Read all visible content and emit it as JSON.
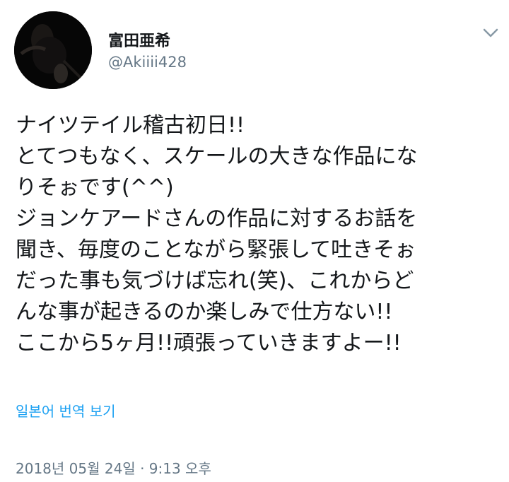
{
  "author": {
    "display_name": "富田亜希",
    "handle": "@Akiiii428",
    "avatar_icon": "profile-photo-icon"
  },
  "menu": {
    "icon": "chevron-down-icon"
  },
  "tweet": {
    "lines": [
      "ナイツテイル稽古初日!!",
      "とてつもなく、スケールの大きな作品にな",
      "りそぉです(^^)",
      "ジョンケアードさんの作品に対するお話を",
      "聞き、毎度のことながら緊張して吐きそぉ",
      "だった事も気づけば忘れ(笑)、これからど",
      "んな事が起きるのか楽しみで仕方ない!!",
      "ここから5ヶ月!!頑張っていきますよー!!"
    ]
  },
  "translate_label": "일본어 번역 보기",
  "timestamp": "2018년 05월 24일 · 9:13 오후",
  "colors": {
    "link": "#1da1f2",
    "secondary_text": "#657786",
    "primary_text": "#14171a"
  }
}
